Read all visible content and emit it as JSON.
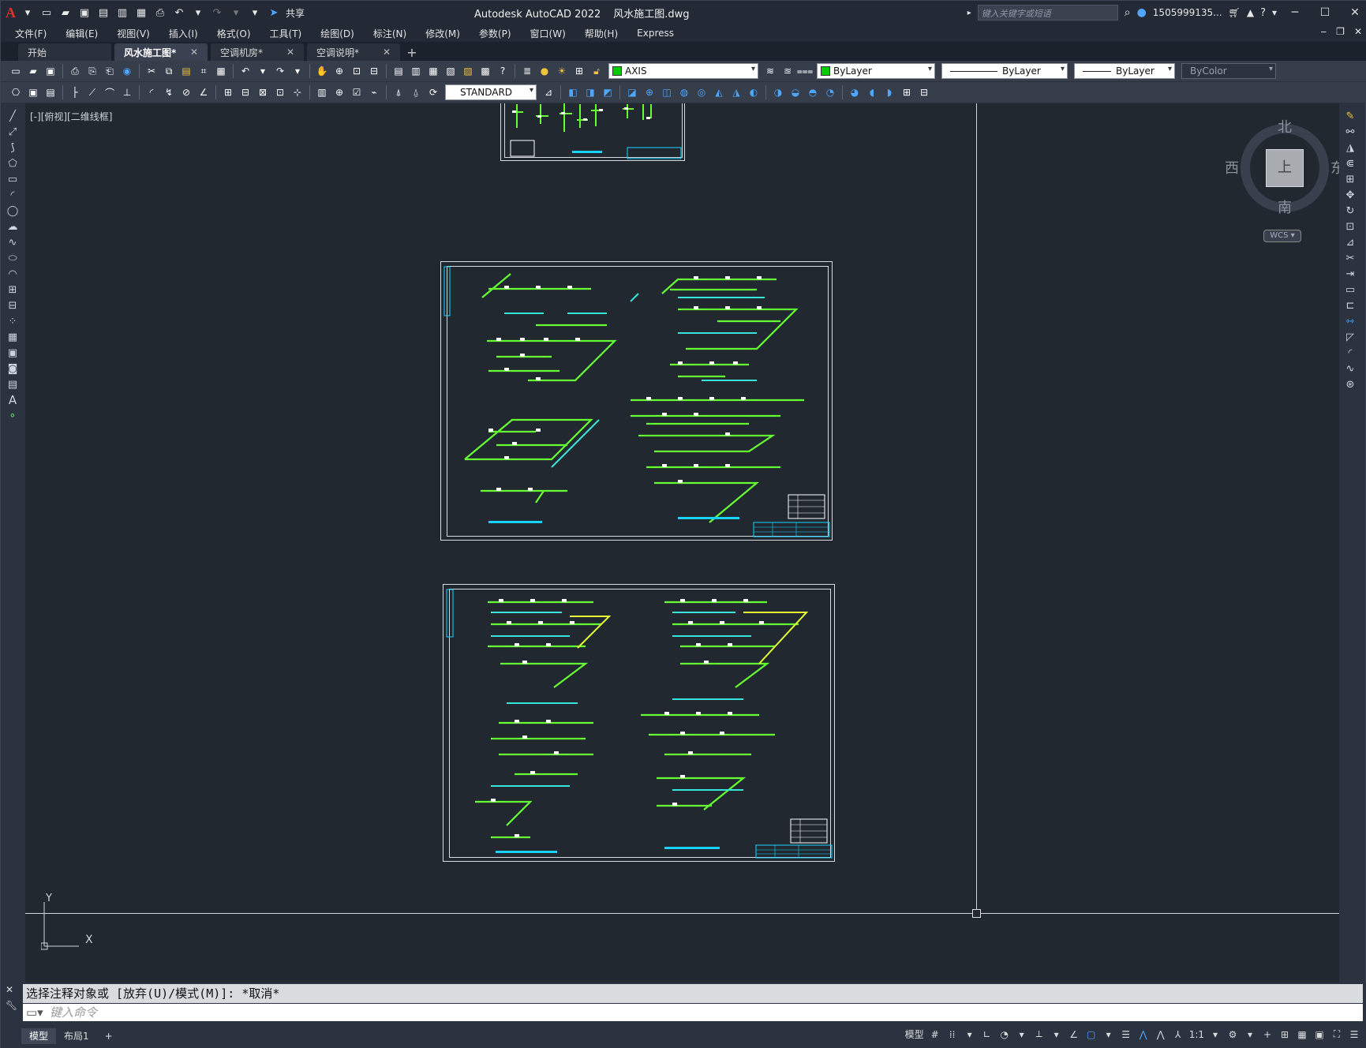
{
  "title": {
    "app": "Autodesk AutoCAD 2022",
    "file": "风水施工图.dwg"
  },
  "quick_access": {
    "share_label": "共享"
  },
  "search": {
    "placeholder": "键入关键字或短语"
  },
  "user": {
    "name": "1505999135..."
  },
  "menu": [
    "文件(F)",
    "编辑(E)",
    "视图(V)",
    "插入(I)",
    "格式(O)",
    "工具(T)",
    "绘图(D)",
    "标注(N)",
    "修改(M)",
    "参数(P)",
    "窗口(W)",
    "帮助(H)",
    "Express"
  ],
  "tabs": [
    {
      "label": "开始",
      "active": false,
      "closable": false
    },
    {
      "label": "风水施工图*",
      "active": true,
      "closable": true
    },
    {
      "label": "空调机房*",
      "active": false,
      "closable": true
    },
    {
      "label": "空调说明*",
      "active": false,
      "closable": true
    }
  ],
  "toolbar": {
    "layer": "AXIS",
    "layer_color": "#00cc00",
    "color": "ByLayer",
    "linetype": "ByLayer",
    "lineweight": "ByLayer",
    "plotstyle": "ByColor",
    "text_style": "STANDARD"
  },
  "viewport": {
    "label": "[-][俯视][二维线框]"
  },
  "viewcube": {
    "north": "北",
    "south": "南",
    "east": "东",
    "west": "西",
    "top_face": "上",
    "wcs": "WCS"
  },
  "ucs": {
    "x": "X",
    "y": "Y"
  },
  "command": {
    "history": "选择注释对象或 [放弃(U)/模式(M)]: *取消*",
    "input_placeholder": "键入命令"
  },
  "layout_tabs": [
    "模型",
    "布局1"
  ],
  "status": {
    "model": "模型",
    "scale": "1:1"
  },
  "colors": {
    "accent": "#4fa7ff",
    "pipe_green": "#66ff33",
    "pipe_cyan": "#33e6d9",
    "pipe_yellow": "#e6ff33",
    "sheet_title": "#19d3ff"
  }
}
